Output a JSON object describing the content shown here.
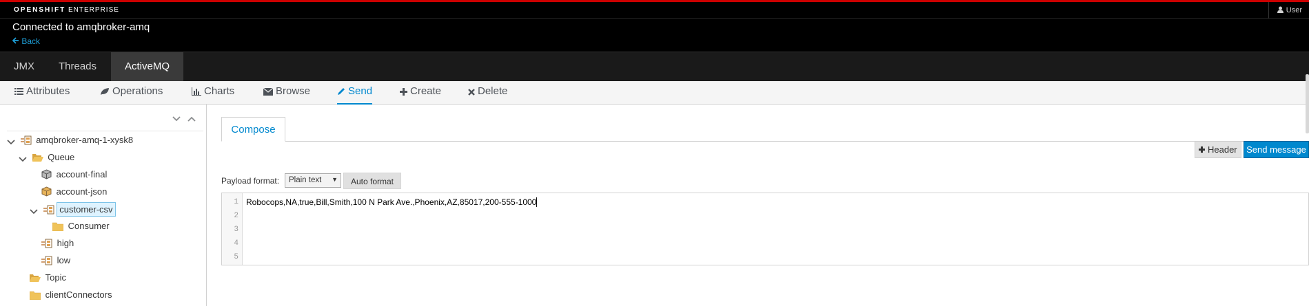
{
  "masthead": {
    "brand_bold": "OPENSHIFT",
    "brand_light": "ENTERPRISE",
    "user_label": "User"
  },
  "connection": {
    "title": "Connected to amqbroker-amq",
    "back_label": "Back"
  },
  "tabs": [
    {
      "label": "JMX",
      "active": false
    },
    {
      "label": "Threads",
      "active": false
    },
    {
      "label": "ActiveMQ",
      "active": true
    }
  ],
  "subnav": [
    {
      "label": "Attributes",
      "icon": "list-icon",
      "active": false
    },
    {
      "label": "Operations",
      "icon": "leaf-icon",
      "active": false
    },
    {
      "label": "Charts",
      "icon": "bar-chart-icon",
      "active": false
    },
    {
      "label": "Browse",
      "icon": "envelope-icon",
      "active": false
    },
    {
      "label": "Send",
      "icon": "pencil-icon",
      "active": true
    },
    {
      "label": "Create",
      "icon": "plus-icon",
      "active": false
    },
    {
      "label": "Delete",
      "icon": "times-icon",
      "active": false
    }
  ],
  "tree": {
    "root": "amqbroker-amq-1-xysk8",
    "queue": "Queue",
    "account_final": "account-final",
    "account_json": "account-json",
    "customer_csv": "customer-csv",
    "consumer": "Consumer",
    "high": "high",
    "low": "low",
    "topic": "Topic",
    "client_connectors": "clientConnectors"
  },
  "compose": {
    "tab_label": "Compose",
    "header_button": "Header",
    "send_button": "Send message",
    "payload_label": "Payload format:",
    "payload_value": "Plain text",
    "auto_format_button": "Auto format",
    "line_numbers": [
      "1",
      "2",
      "3",
      "4",
      "5"
    ],
    "line1": "Robocops,NA,true,Bill,Smith,100 N Park Ave.,Phoenix,AZ,85017,200-555-1000"
  },
  "colors": {
    "accent": "#0088ce",
    "top_stripe": "#cc0000"
  }
}
